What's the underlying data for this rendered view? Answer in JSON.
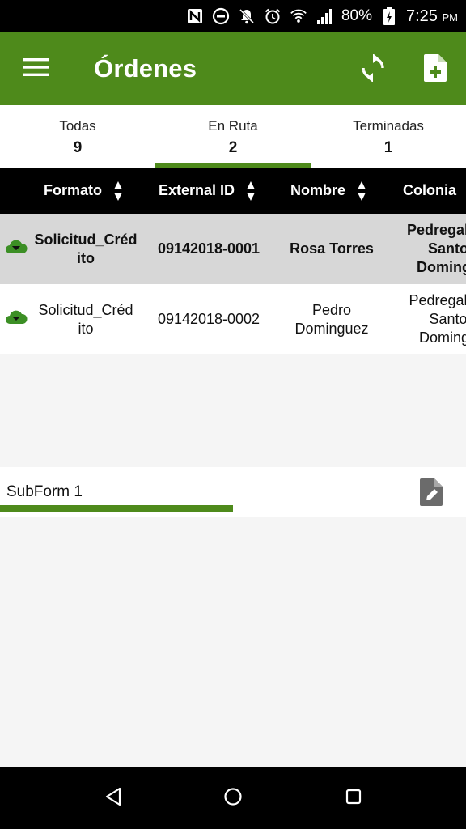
{
  "status_bar": {
    "battery": "80%",
    "time": "7:25",
    "ampm": "PM",
    "icons": [
      "nfc-icon",
      "do-not-disturb-icon",
      "notifications-off-icon",
      "alarm-icon",
      "wifi-icon",
      "signal-icon",
      "battery-charging-icon"
    ]
  },
  "app_bar": {
    "title": "Órdenes",
    "icons": [
      "menu-icon",
      "refresh-icon",
      "new-document-icon"
    ]
  },
  "tabs": [
    {
      "label": "Todas",
      "count": "9",
      "selected": false
    },
    {
      "label": "En Ruta",
      "count": "2",
      "selected": true
    },
    {
      "label": "Terminadas",
      "count": "1",
      "selected": false
    }
  ],
  "table": {
    "columns": [
      "Formato",
      "External ID",
      "Nombre",
      "Colonia"
    ],
    "rows": [
      {
        "formato": "Solicitud_Créd ito",
        "external_id": "09142018-0001",
        "nombre": "Rosa Torres",
        "colonia": "Pedregal de Santo Domingo",
        "selected": true
      },
      {
        "formato": "Solicitud_Créd ito",
        "external_id": "09142018-0002",
        "nombre": "Pedro Dominguez",
        "colonia": "Pedregal de Santo Domingo",
        "selected": false
      }
    ]
  },
  "subform": {
    "label": "SubForm 1",
    "progress": 0.5
  },
  "colors": {
    "primary": "#4e8a1b",
    "header_bg": "#000000",
    "selected_row": "#d7d7d7",
    "background": "#f5f5f5"
  },
  "nav_bar": {
    "icons": [
      "back-icon",
      "home-icon",
      "recents-icon"
    ]
  }
}
